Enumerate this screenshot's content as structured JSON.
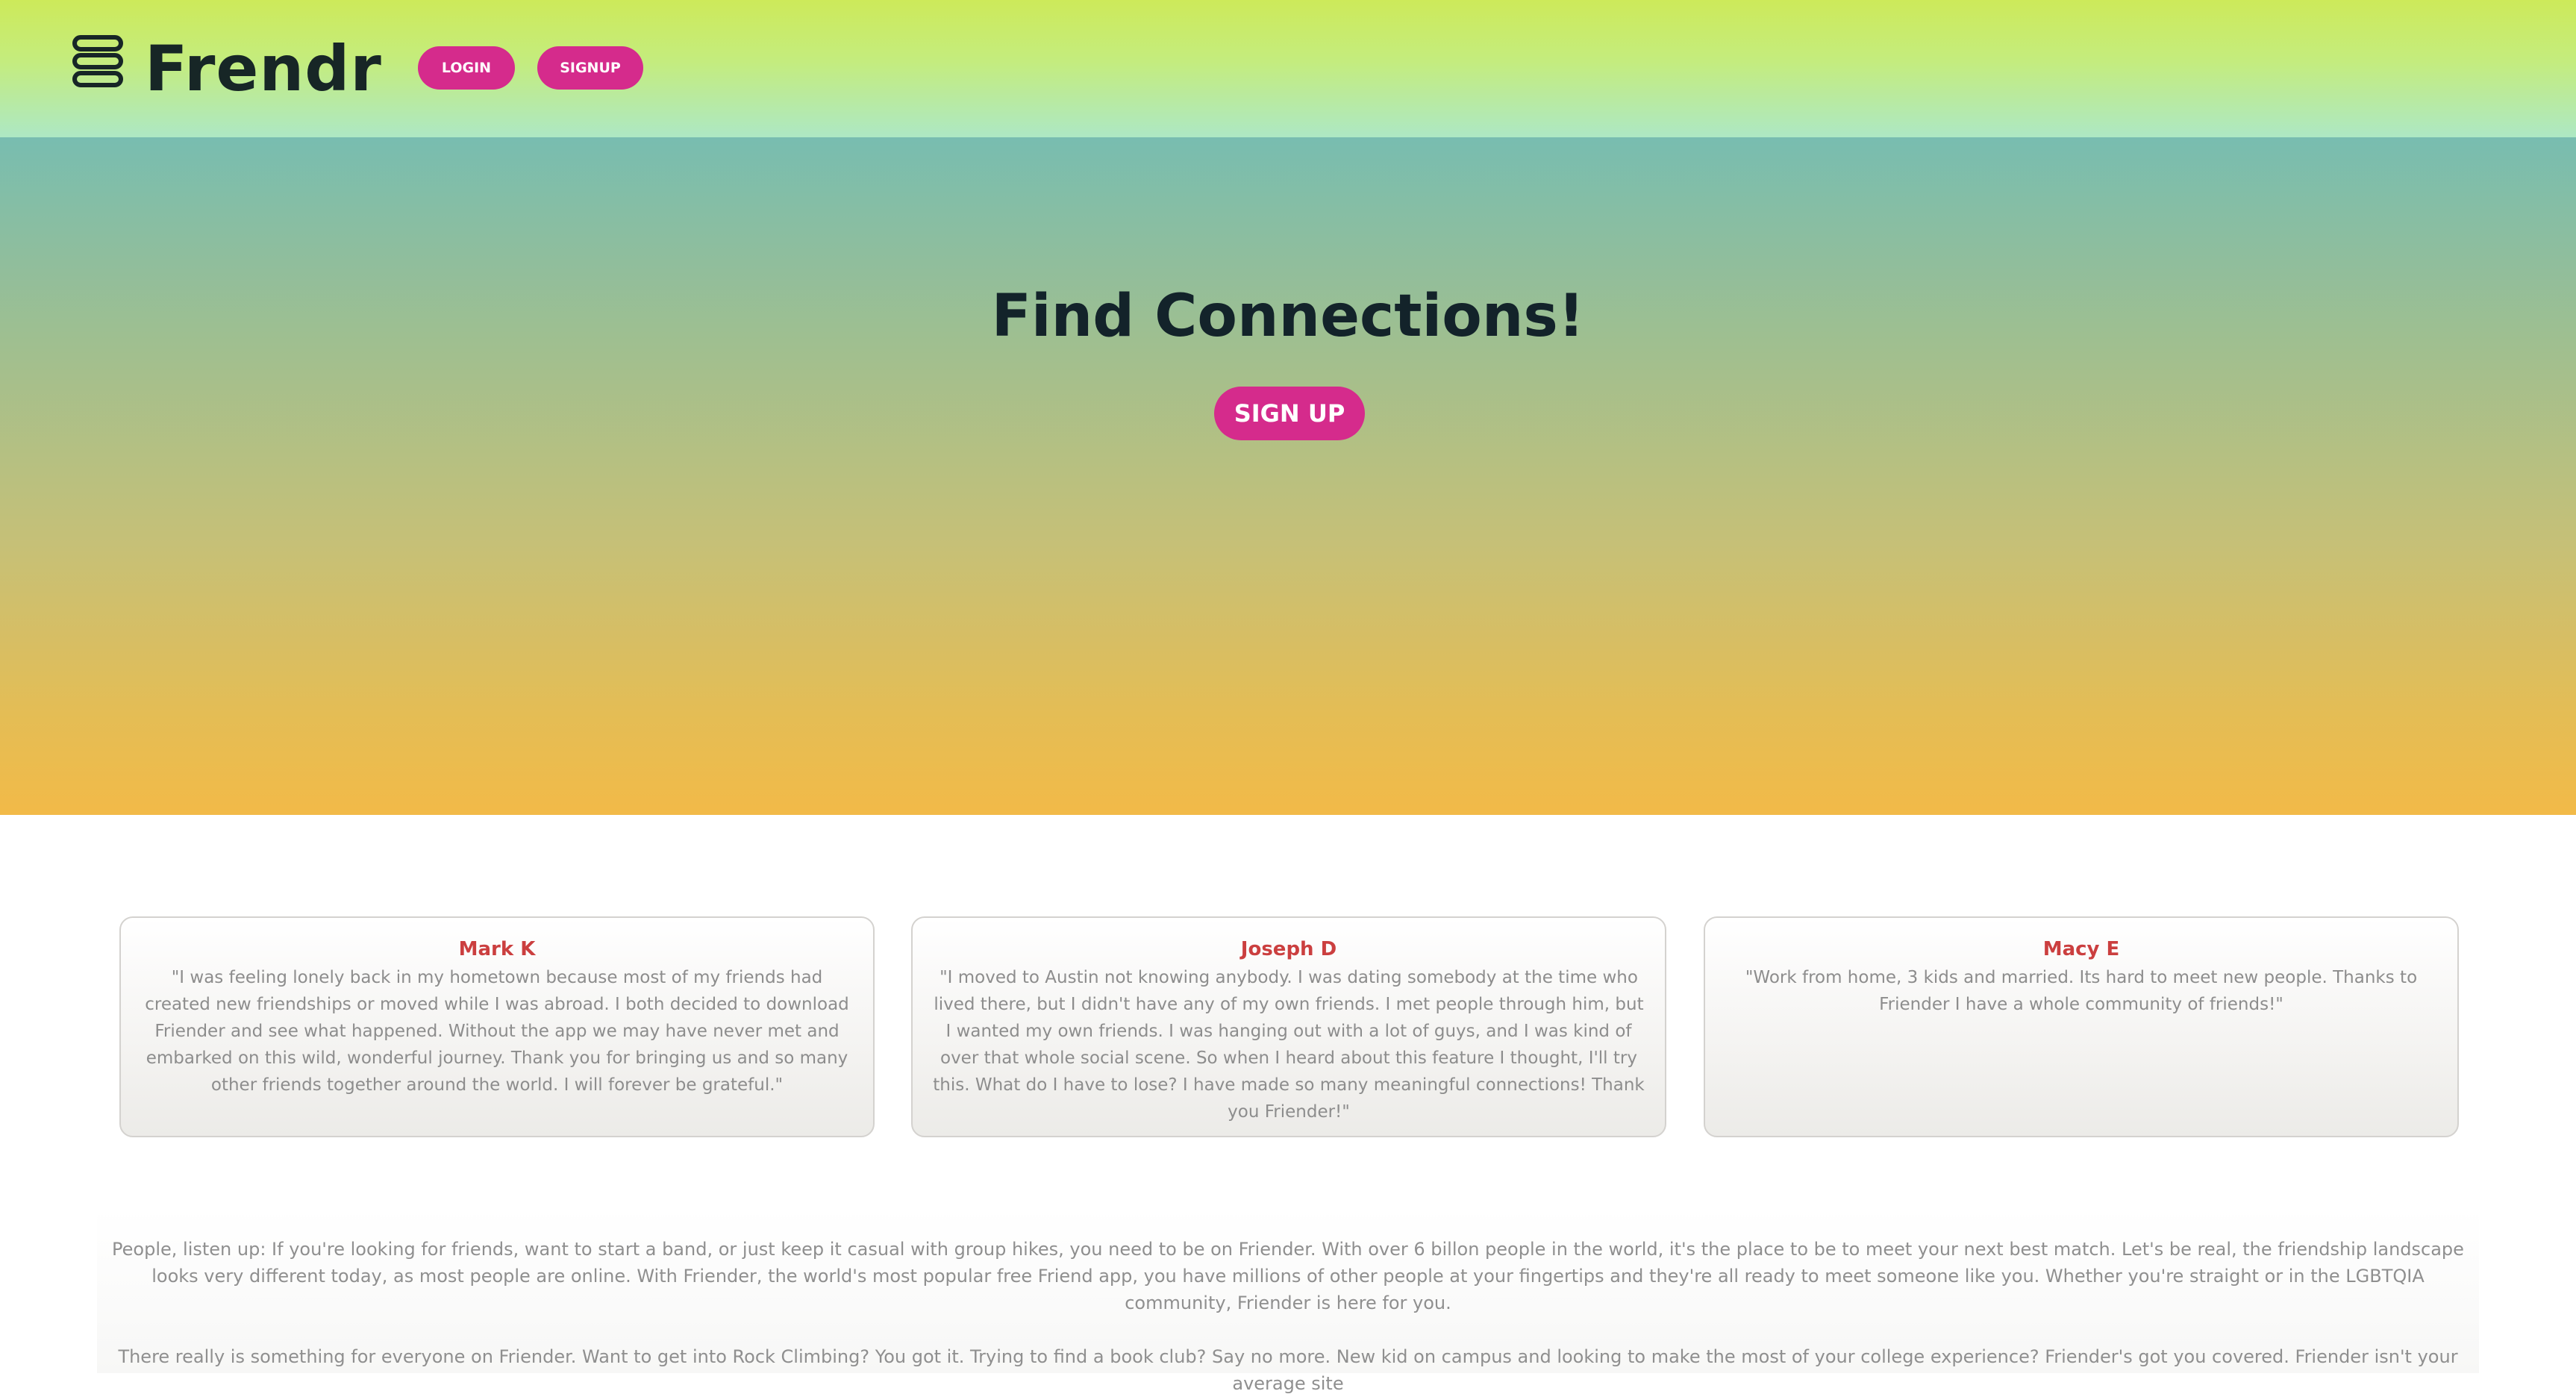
{
  "header": {
    "brand": "Frendr",
    "menu_icon": "stack-menu-icon",
    "login_label": "LOGIN",
    "signup_label": "SIGNUP"
  },
  "hero": {
    "title": "Find Connections!",
    "cta_label": "SIGN UP"
  },
  "testimonials": [
    {
      "name": "Mark K",
      "quote": "\"I was feeling lonely back in my hometown because most of my friends had created new friendships or moved while I was abroad. I both decided to download Friender and see what happened. Without the app we may have never met and embarked on this wild, wonderful journey. Thank you for bringing us and so many other friends together around the world. I will forever be grateful.\""
    },
    {
      "name": "Joseph D",
      "quote": "\"I moved to Austin not knowing anybody. I was dating somebody at the time who lived there, but I didn't have any of my own friends. I met people through him, but I wanted my own friends. I was hanging out with a lot of guys, and I was kind of over that whole social scene. So when I heard about this feature I thought, I'll try this. What do I have to lose? I have made so many meaningful connections! Thank you Friender!\""
    },
    {
      "name": "Macy E",
      "quote": "\"Work from home, 3 kids and married. Its hard to meet new people. Thanks to Friender I have a whole community of friends!\""
    }
  ],
  "about": {
    "paragraph_1": "People, listen up: If you're looking for friends, want to start a band, or just keep it casual with group hikes, you need to be on Friender. With over 6 billon people in the world, it's the place to be to meet your next best match. Let's be real, the friendship landscape looks very different today, as most people are online. With Friender, the world's most popular free Friend app, you have millions of other people at your fingertips and they're all ready to meet someone like you. Whether you're straight or in the LGBTQIA community, Friender is here for you.",
    "paragraph_2": "There really is something for everyone on Friender. Want to get into Rock Climbing? You got it. Trying to find a book club? Say no more. New kid on campus and looking to make the most of your college experience? Friender's got you covered. Friender isn't your average site"
  },
  "colors": {
    "accent": "#d52b8c",
    "name_red": "#cb3f3f",
    "header_top": "#cdea5a",
    "hero_bottom": "#f2ba48"
  }
}
